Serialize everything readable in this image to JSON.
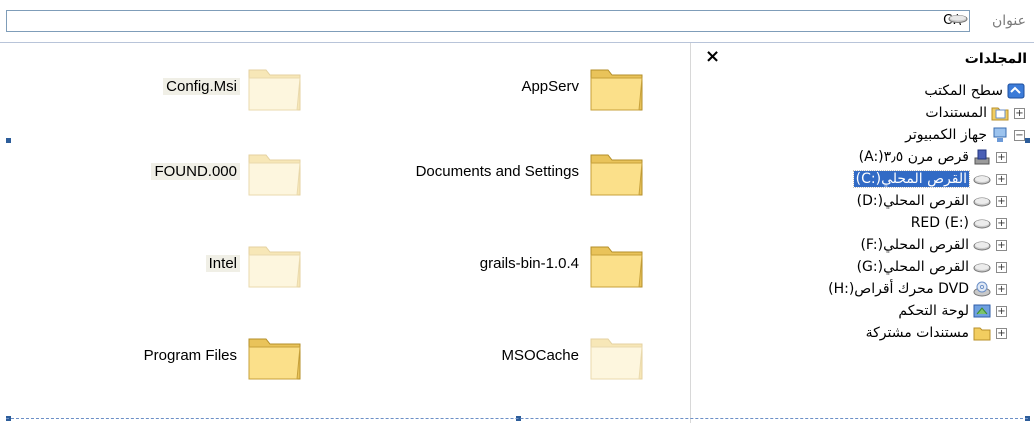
{
  "address": {
    "label": "عنوان",
    "value": "C:\\"
  },
  "folders_pane": {
    "title": "المجلدات",
    "close": "×",
    "tree": [
      {
        "label": "سطح المكتب",
        "icon": "desktop-icon",
        "expander": ""
      },
      {
        "label": "المستندات",
        "icon": "my-documents-icon",
        "expander": "+"
      },
      {
        "label": "جهاز الكمبيوتر",
        "icon": "my-computer-icon",
        "expander": "−"
      },
      {
        "label": "(A:)قرص مرن ٣٫٥",
        "icon": "floppy-drive-icon",
        "expander": "+"
      },
      {
        "label": "(C:)القرص المحلي",
        "icon": "hard-drive-icon",
        "expander": "+"
      },
      {
        "label": "(D:)القرص المحلي",
        "icon": "hard-drive-icon",
        "expander": "+"
      },
      {
        "label": "RED (E:)",
        "icon": "hard-drive-icon",
        "expander": "+"
      },
      {
        "label": "(F:)القرص المحلي",
        "icon": "hard-drive-icon",
        "expander": "+"
      },
      {
        "label": "(G:)القرص المحلي",
        "icon": "hard-drive-icon",
        "expander": "+"
      },
      {
        "label": "(H:)محرك أقراص DVD",
        "icon": "dvd-drive-icon",
        "expander": "+"
      },
      {
        "label": "لوحة التحكم",
        "icon": "control-panel-icon",
        "expander": "+"
      },
      {
        "label": "مستندات مشتركة",
        "icon": "shared-folder-icon",
        "expander": "+"
      }
    ]
  },
  "files": [
    {
      "name": "AppServ",
      "hidden": false
    },
    {
      "name": "Config.Msi",
      "hidden": true
    },
    {
      "name": "Documents and Settings",
      "hidden": false
    },
    {
      "name": "FOUND.000",
      "hidden": true
    },
    {
      "name": "grails-bin-1.0.4",
      "hidden": false
    },
    {
      "name": "Intel",
      "hidden": true
    },
    {
      "name": "MSOCache",
      "hidden": true
    },
    {
      "name": "Program Files",
      "hidden": false
    }
  ],
  "colors": {
    "selection": "#316ac5",
    "folder": "#f7d777",
    "folder_hidden": "#fbeec5"
  }
}
